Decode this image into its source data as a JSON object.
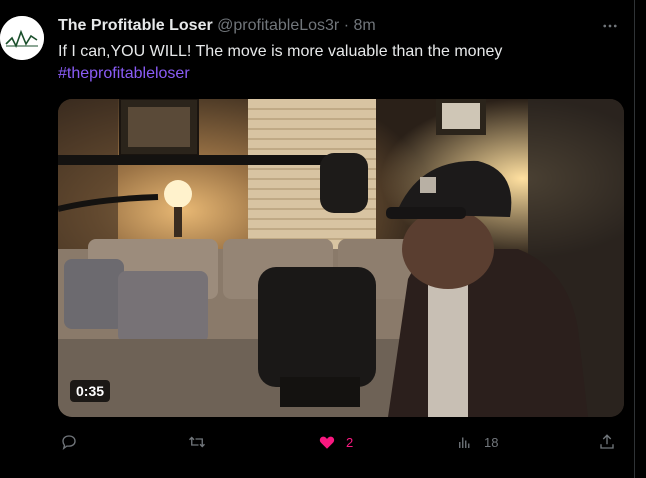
{
  "author": {
    "name": "The Profitable Loser",
    "handle": "@profitableLos3r",
    "separator": "·",
    "time": "8m",
    "avatar_icon": "chart-logo-icon"
  },
  "tweet": {
    "text": "If I can,YOU WILL! The move is more valuable than the money",
    "hashtag": "#theprofitableloser"
  },
  "media": {
    "kind": "video",
    "duration": "0:35"
  },
  "actions": {
    "replies_icon": "reply-icon",
    "retweets_icon": "retweet-icon",
    "likes_icon": "heart-icon",
    "likes": "2",
    "views_icon": "views-icon",
    "views": "18",
    "share_icon": "share-icon"
  },
  "colors": {
    "background": "#000000",
    "text": "#e7e9ea",
    "muted": "#71767b",
    "hashtag": "#8a5cf6",
    "like": "#f91880"
  }
}
